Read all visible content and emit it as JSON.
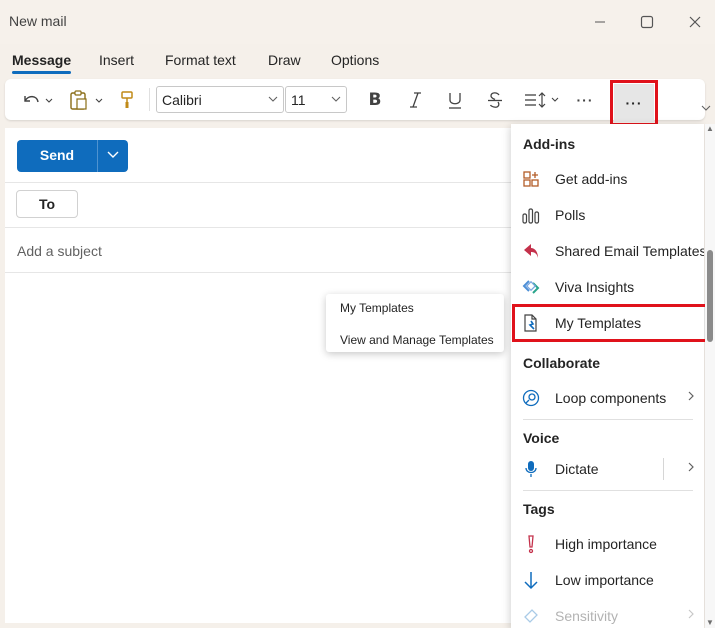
{
  "window": {
    "title": "New mail"
  },
  "tabs": [
    "Message",
    "Insert",
    "Format text",
    "Draw",
    "Options"
  ],
  "toolbar": {
    "font": "Calibri",
    "size": "11",
    "more": "···"
  },
  "compose": {
    "send_label": "Send",
    "to_label": "To",
    "subject_placeholder": "Add a subject"
  },
  "templates_popup": {
    "items": [
      "My Templates",
      "View and Manage Templates"
    ]
  },
  "menu": {
    "sections": [
      "Add-ins",
      "Collaborate",
      "Voice",
      "Tags"
    ],
    "addins": [
      "Get add-ins",
      "Polls",
      "Shared Email Templates",
      "Viva Insights",
      "My Templates"
    ],
    "collaborate": [
      "Loop components"
    ],
    "voice": [
      "Dictate"
    ],
    "tags": [
      "High importance",
      "Low importance",
      "Sensitivity"
    ]
  },
  "colors": {
    "accent": "#0f6cbd",
    "highlight": "#e0121b"
  }
}
